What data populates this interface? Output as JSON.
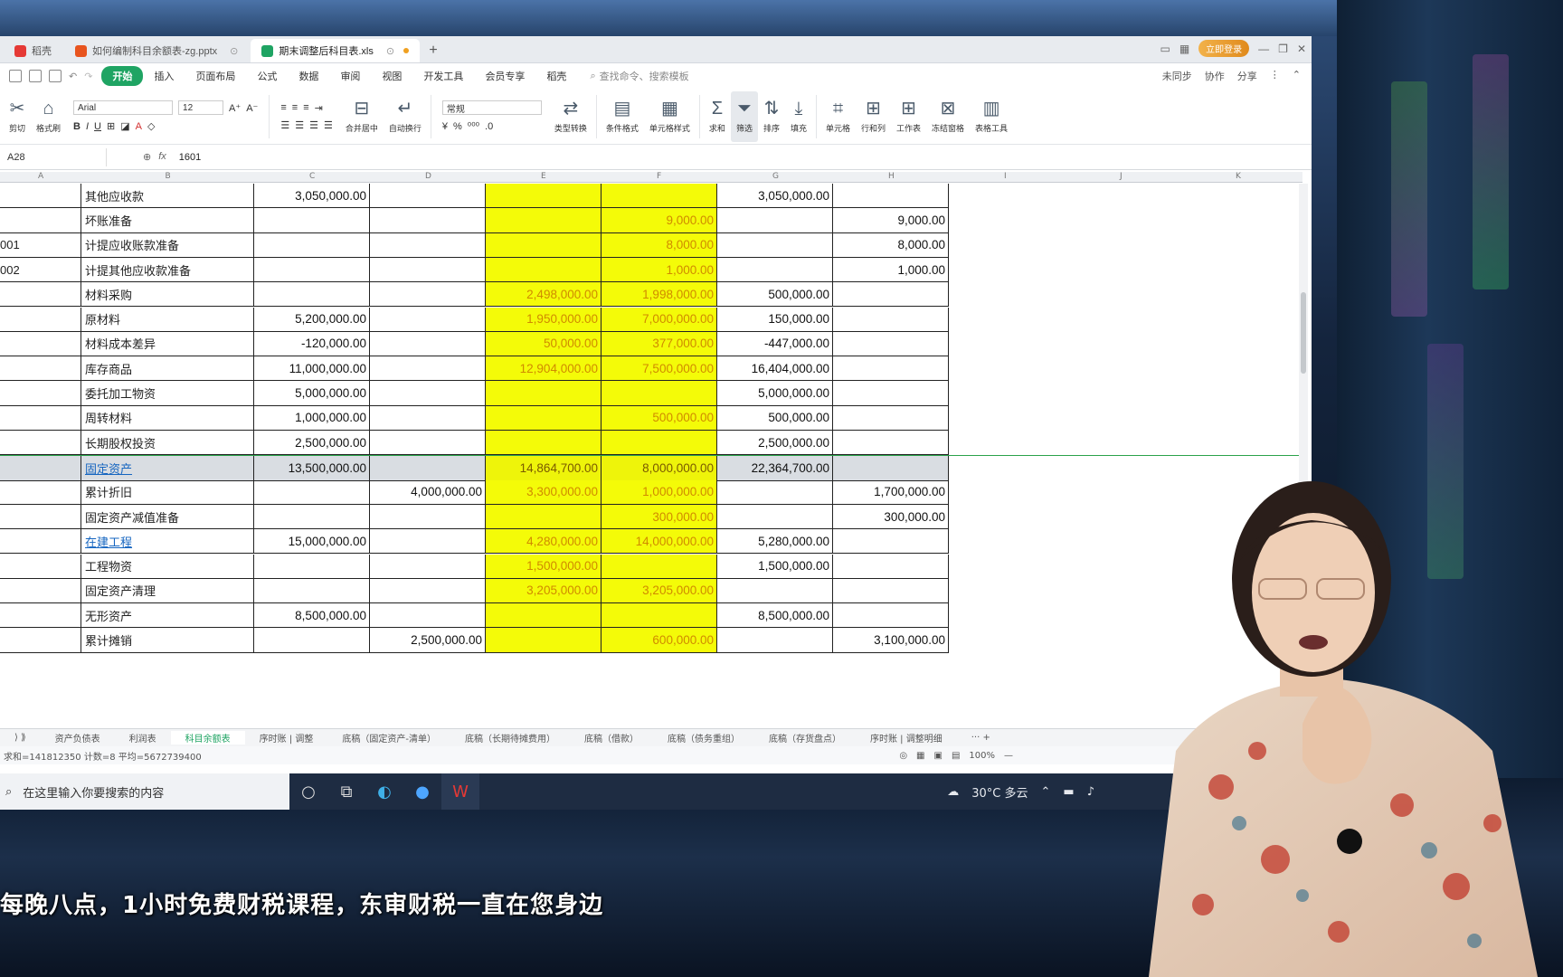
{
  "window": {
    "tabs": [
      {
        "label": "稻壳",
        "color": "#e53935"
      },
      {
        "label": "如何编制科目余额表-zg.pptx",
        "color": "#e8541e"
      },
      {
        "label": "期末调整后科目表.xls",
        "color": "#1fa463",
        "active": true
      }
    ],
    "vip_label": "立即登录"
  },
  "menu": {
    "items": [
      "开始",
      "插入",
      "页面布局",
      "公式",
      "数据",
      "审阅",
      "视图",
      "开发工具",
      "会员专享",
      "稻壳"
    ],
    "active": "开始",
    "search_placeholder": "查找命令、搜索模板",
    "right": [
      "未同步",
      "协作",
      "分享"
    ]
  },
  "ribbon": {
    "font_name": "Arial",
    "font_size": "12",
    "number_format": "常规",
    "groups": [
      "合并居中",
      "自动换行",
      "类型转换",
      "条件格式",
      "单元格样式",
      "求和",
      "筛选",
      "排序",
      "填充",
      "单元格",
      "行和列",
      "工作表",
      "冻结窗格",
      "表格工具"
    ],
    "left_labels": [
      "剪切",
      "格式刷"
    ]
  },
  "formula_bar": {
    "name_box": "A28",
    "value": "1601"
  },
  "columns": [
    "A",
    "B",
    "C",
    "D",
    "E",
    "F",
    "G",
    "H",
    "I",
    "J",
    "K"
  ],
  "rows": [
    {
      "code": "",
      "name": "其他应收款",
      "C": "3,050,000.00",
      "D": "",
      "E": "",
      "F": "",
      "G": "3,050,000.00",
      "H": ""
    },
    {
      "code": "",
      "name": "坏账准备",
      "C": "",
      "D": "",
      "E": "",
      "F": "9,000.00",
      "G": "",
      "H": "9,000.00"
    },
    {
      "code": "001",
      "name": "计提应收账款准备",
      "C": "",
      "D": "",
      "E": "",
      "F": "8,000.00",
      "G": "",
      "H": "8,000.00"
    },
    {
      "code": "002",
      "name": "计提其他应收款准备",
      "C": "",
      "D": "",
      "E": "",
      "F": "1,000.00",
      "G": "",
      "H": "1,000.00"
    },
    {
      "code": "",
      "name": "材料采购",
      "C": "",
      "D": "",
      "E": "2,498,000.00",
      "F": "1,998,000.00",
      "G": "500,000.00",
      "H": ""
    },
    {
      "code": "",
      "name": "原材料",
      "C": "5,200,000.00",
      "D": "",
      "E": "1,950,000.00",
      "F": "7,000,000.00",
      "G": "150,000.00",
      "H": ""
    },
    {
      "code": "",
      "name": "材料成本差异",
      "C": "-120,000.00",
      "D": "",
      "E": "50,000.00",
      "F": "377,000.00",
      "G": "-447,000.00",
      "H": ""
    },
    {
      "code": "",
      "name": "库存商品",
      "C": "11,000,000.00",
      "D": "",
      "E": "12,904,000.00",
      "F": "7,500,000.00",
      "G": "16,404,000.00",
      "H": ""
    },
    {
      "code": "",
      "name": "委托加工物资",
      "C": "5,000,000.00",
      "D": "",
      "E": "",
      "F": "",
      "G": "5,000,000.00",
      "H": ""
    },
    {
      "code": "",
      "name": "周转材料",
      "C": "1,000,000.00",
      "D": "",
      "E": "",
      "F": "500,000.00",
      "G": "500,000.00",
      "H": ""
    },
    {
      "code": "",
      "name": "长期股权投资",
      "C": "2,500,000.00",
      "D": "",
      "E": "",
      "F": "",
      "G": "2,500,000.00",
      "H": ""
    },
    {
      "code": "",
      "name": "固定资产",
      "C": "13,500,000.00",
      "D": "",
      "E": "14,864,700.00",
      "F": "8,000,000.00",
      "G": "22,364,700.00",
      "H": "",
      "link": true,
      "selected": true
    },
    {
      "code": "",
      "name": "累计折旧",
      "C": "",
      "D": "4,000,000.00",
      "E": "3,300,000.00",
      "F": "1,000,000.00",
      "G": "",
      "H": "1,700,000.00"
    },
    {
      "code": "",
      "name": "固定资产减值准备",
      "C": "",
      "D": "",
      "E": "",
      "F": "300,000.00",
      "G": "",
      "H": "300,000.00"
    },
    {
      "code": "",
      "name": "在建工程",
      "C": "15,000,000.00",
      "D": "",
      "E": "4,280,000.00",
      "F": "14,000,000.00",
      "G": "5,280,000.00",
      "H": "",
      "link": true
    },
    {
      "code": "",
      "name": "工程物资",
      "C": "",
      "D": "",
      "E": "1,500,000.00",
      "F": "",
      "G": "1,500,000.00",
      "H": ""
    },
    {
      "code": "",
      "name": "固定资产清理",
      "C": "",
      "D": "",
      "E": "3,205,000.00",
      "F": "3,205,000.00",
      "G": "",
      "H": ""
    },
    {
      "code": "",
      "name": "无形资产",
      "C": "8,500,000.00",
      "D": "",
      "E": "",
      "F": "",
      "G": "8,500,000.00",
      "H": ""
    },
    {
      "code": "",
      "name": "累计摊销",
      "C": "",
      "D": "2,500,000.00",
      "E": "",
      "F": "600,000.00",
      "G": "",
      "H": "3,100,000.00"
    }
  ],
  "sheets": [
    "资产负债表",
    "利润表",
    "科目余额表",
    "序时账 | 调整",
    "底稿（固定资产-清单）",
    "底稿（长期待摊费用）",
    "底稿（借款）",
    "底稿（债务重组）",
    "底稿（存货盘点）",
    "序时账 | 调整明细"
  ],
  "active_sheet": "科目余额表",
  "status": {
    "left": "求和=141812350 计数=8 平均=5672739400",
    "zoom": "100%"
  },
  "taskbar": {
    "search_text": "在这里输入你要搜索的内容",
    "weather": "30°C 多云"
  },
  "subtitle": "每晚八点，1小时免费财税课程，东审财税一直在您身边"
}
